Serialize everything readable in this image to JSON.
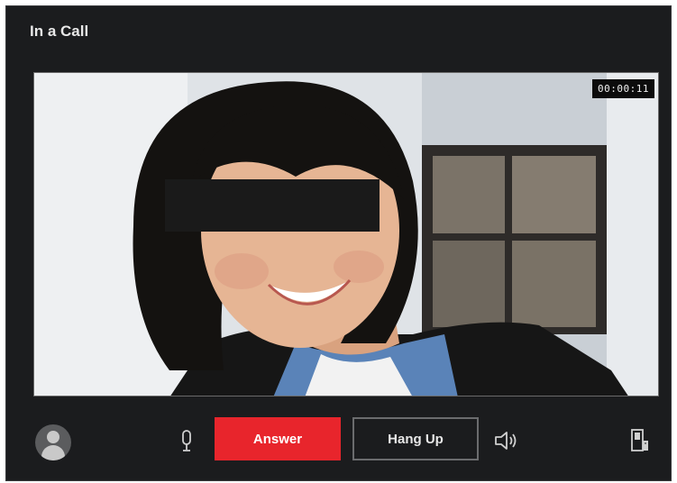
{
  "dialog": {
    "title": "In a Call"
  },
  "video": {
    "timer": "00:00:11"
  },
  "controls": {
    "answer_label": "Answer",
    "hangup_label": "Hang Up"
  },
  "icons": {
    "avatar": "user-avatar-icon",
    "mic": "microphone-icon",
    "speaker": "speaker-volume-icon",
    "door": "door-unlock-icon"
  },
  "colors": {
    "accent": "#e8252c",
    "dialog_bg": "#1b1c1e"
  }
}
